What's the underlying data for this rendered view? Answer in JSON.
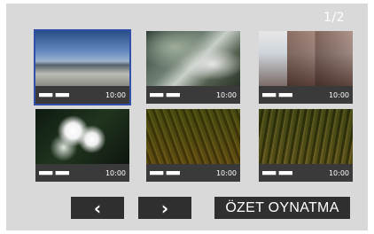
{
  "page_indicator": "1/2",
  "thumbnails": [
    {
      "date": "■■■■ ■■■■",
      "time": "10:00",
      "scene": "beach"
    },
    {
      "date": "■■■■ ■■■■",
      "time": "10:00",
      "scene": "river"
    },
    {
      "date": "■■■■ ■■■■",
      "time": "10:00",
      "scene": "buildings"
    },
    {
      "date": "■■■■ ■■■■",
      "time": "10:00",
      "scene": "flower"
    },
    {
      "date": "■■■■ ■■■■",
      "time": "10:00",
      "scene": "grass"
    },
    {
      "date": "■■■■ ■■■■",
      "time": "10:00",
      "scene": "grass"
    }
  ],
  "buttons": {
    "prev": "‹",
    "next": "›",
    "summary": "ÖZET OYNATMA"
  },
  "colors": {
    "background": "#d9d9d9",
    "button": "#2f2f2f",
    "selection": "#2f4fa8"
  }
}
